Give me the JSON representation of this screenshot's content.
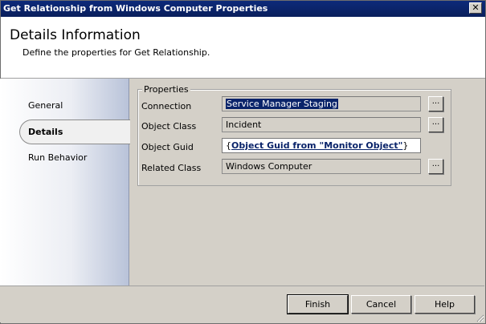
{
  "window": {
    "title": "Get Relationship from Windows Computer Properties",
    "close_glyph": "✕"
  },
  "header": {
    "title": "Details Information",
    "subtitle": "Define the properties for Get Relationship."
  },
  "nav": {
    "items": [
      {
        "label": "General"
      },
      {
        "label": "Details"
      },
      {
        "label": "Run Behavior"
      }
    ],
    "selected": "Details"
  },
  "properties": {
    "group_label": "Properties",
    "connection": {
      "label": "Connection",
      "value": "Service Manager Staging"
    },
    "object_class": {
      "label": "Object Class",
      "value": "Incident"
    },
    "object_guid": {
      "label": "Object Guid",
      "open": "{",
      "value": "Object Guid from \"Monitor Object\"",
      "close": "}"
    },
    "related_class": {
      "label": "Related Class",
      "value": "Windows Computer"
    },
    "browse_label": "..."
  },
  "footer": {
    "finish": "Finish",
    "cancel": "Cancel",
    "help": "Help"
  },
  "colors": {
    "title_bar": "#0a246a",
    "dialog_face": "#d4d0c8",
    "selection": "#0a246a"
  }
}
